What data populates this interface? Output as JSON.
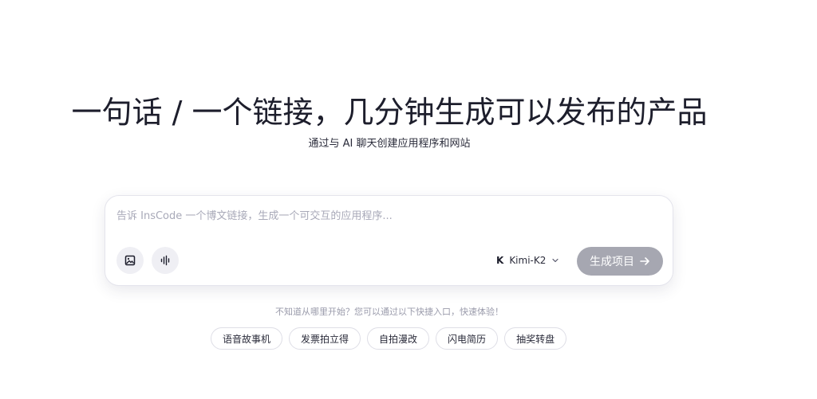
{
  "hero": {
    "title": "一句话 / 一个链接，几分钟生成可以发布的产品",
    "subtitle": "通过与 AI 聊天创建应用程序和网站"
  },
  "prompt": {
    "placeholder": "告诉 InsCode 一个博文链接，生成一个可交互的应用程序...",
    "value": "",
    "image_button_icon": "image-icon",
    "voice_button_icon": "voice-waveform-icon",
    "model": {
      "logo": "K",
      "name": "Kimi-K2",
      "chevron": "chevron-down-icon"
    },
    "generate_label": "生成项目",
    "generate_icon": "arrow-right-icon",
    "generate_color": "#a6a7b1"
  },
  "hint": "不知道从哪里开始？您可以通过以下快捷入口，快速体验！",
  "chips": [
    "语音故事机",
    "发票拍立得",
    "自拍漫改",
    "闪电简历",
    "抽奖转盘"
  ]
}
